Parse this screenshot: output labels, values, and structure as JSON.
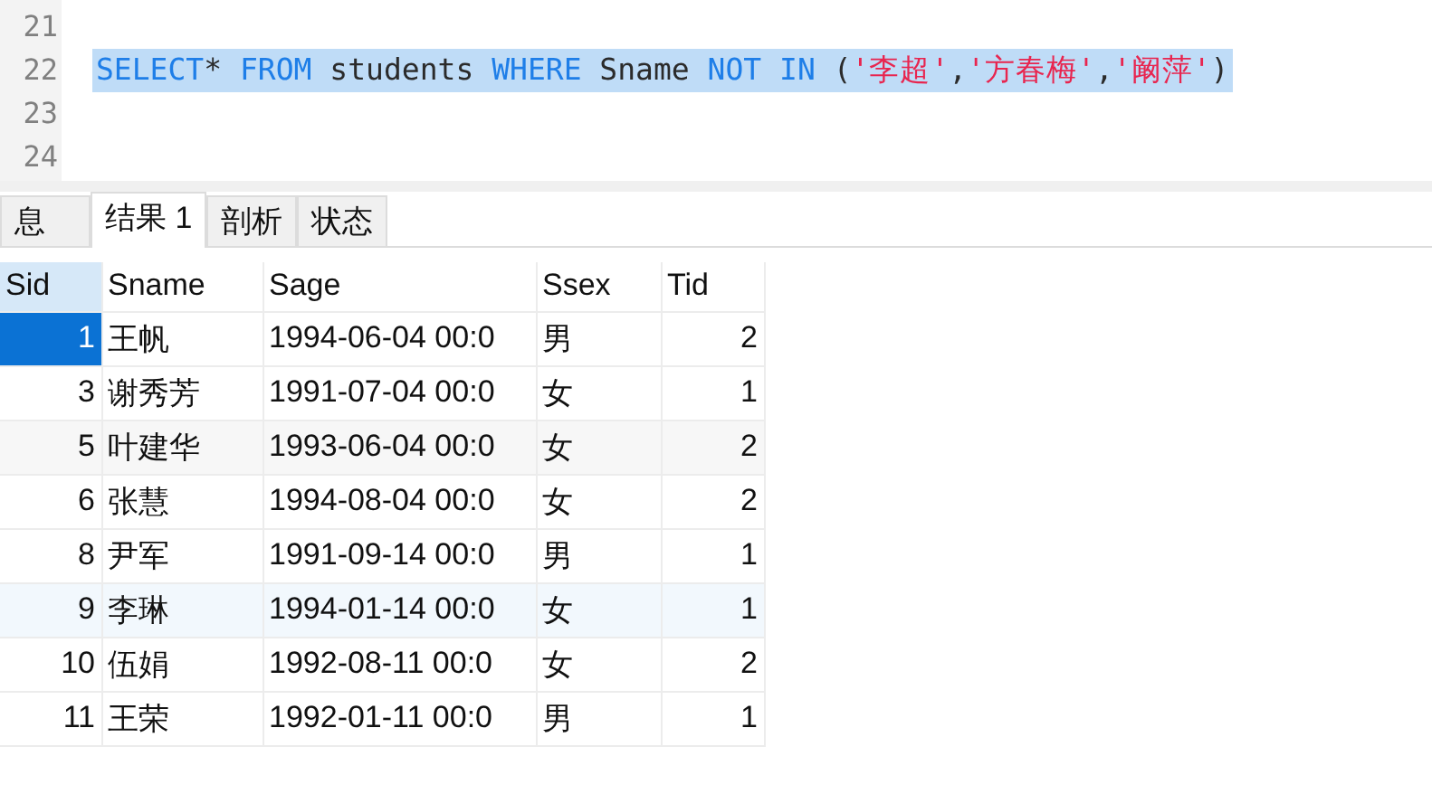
{
  "editor": {
    "statement_selected": true,
    "lines": [
      {
        "number": "21"
      },
      {
        "number": "22",
        "tokens": [
          {
            "kind": "keyword",
            "text": "SELECT"
          },
          {
            "kind": "plain",
            "text": "* "
          },
          {
            "kind": "keyword",
            "text": "FROM"
          },
          {
            "kind": "plain",
            "text": " students "
          },
          {
            "kind": "keyword",
            "text": "WHERE"
          },
          {
            "kind": "plain",
            "text": " Sname "
          },
          {
            "kind": "keyword",
            "text": "NOT IN"
          },
          {
            "kind": "plain",
            "text": " ("
          },
          {
            "kind": "string",
            "text": "'李超'"
          },
          {
            "kind": "plain",
            "text": ","
          },
          {
            "kind": "string",
            "text": "'方春梅'"
          },
          {
            "kind": "plain",
            "text": ","
          },
          {
            "kind": "string",
            "text": "'阚萍'"
          },
          {
            "kind": "plain",
            "text": ")"
          }
        ]
      },
      {
        "number": "23"
      },
      {
        "number": "24"
      }
    ]
  },
  "tabs": [
    {
      "label": "息",
      "selected": false
    },
    {
      "label": "结果 1",
      "selected": true
    },
    {
      "label": "剖析",
      "selected": false
    },
    {
      "label": "状态",
      "selected": false
    }
  ],
  "table": {
    "columns": [
      "Sid",
      "Sname",
      "Sage",
      "Ssex",
      "Tid"
    ],
    "rows": [
      {
        "kind": "plain",
        "selected": true,
        "cells": [
          "1",
          "王帆",
          "1994-06-04 00:0",
          "男",
          "2"
        ]
      },
      {
        "kind": "plain",
        "selected": false,
        "cells": [
          "3",
          "谢秀芳",
          "1991-07-04 00:0",
          "女",
          "1"
        ]
      },
      {
        "kind": "shaded",
        "selected": false,
        "cells": [
          "5",
          "叶建华",
          "1993-06-04 00:0",
          "女",
          "2"
        ]
      },
      {
        "kind": "plain",
        "selected": false,
        "cells": [
          "6",
          "张慧",
          "1994-08-04 00:0",
          "女",
          "2"
        ]
      },
      {
        "kind": "plain",
        "selected": false,
        "cells": [
          "8",
          "尹军",
          "1991-09-14 00:0",
          "男",
          "1"
        ]
      },
      {
        "kind": "hover",
        "selected": false,
        "cells": [
          "9",
          "李琳",
          "1994-01-14 00:0",
          "女",
          "1"
        ]
      },
      {
        "kind": "plain",
        "selected": false,
        "cells": [
          "10",
          "伍娟",
          "1992-08-11 00:0",
          "女",
          "2"
        ]
      },
      {
        "kind": "plain",
        "selected": false,
        "cells": [
          "11",
          "王荣",
          "1992-01-11 00:0",
          "男",
          "1"
        ]
      }
    ]
  }
}
